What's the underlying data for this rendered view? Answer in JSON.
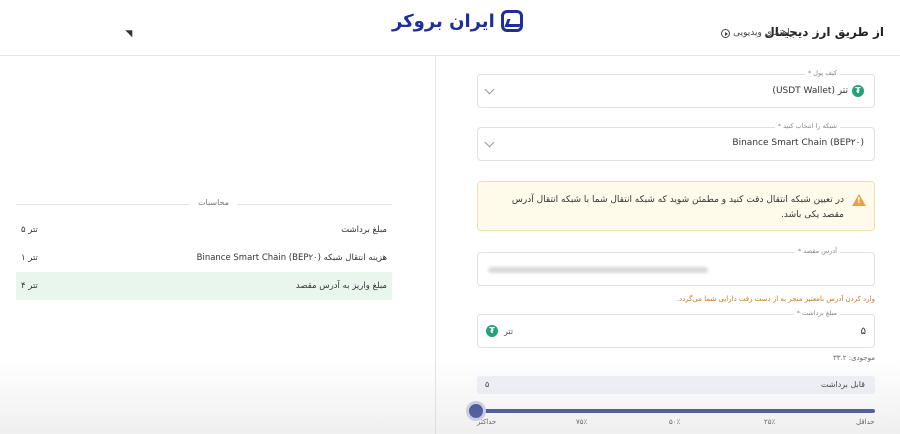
{
  "header": {
    "title": "از طریق ارز دیجیتال",
    "video_guide": "راهنمای ویدیویی",
    "logo_text": "ایران بروکر"
  },
  "form": {
    "wallet": {
      "label": "کیف پول *",
      "value": "تتر (USDT Wallet)"
    },
    "network": {
      "label": "شبکه را انتخاب کنید *",
      "value": "Binance Smart Chain (BEP۲۰)"
    },
    "warning": "در تعیین شبکه انتقال دقت کنید و مطمئن شوید که شبکه انتقال شما با شبکه انتقال آدرس مقصد یکی باشد.",
    "address": {
      "label": "آدرس مقصد *",
      "hint": "وارد کردن آدرس نامعتبر منجر به از دست رفت دارایی شما می‌گردد."
    },
    "amount": {
      "label": "مبلغ برداشت *",
      "value": "۵",
      "unit": "تتر"
    },
    "balance": "موجودی: ۳۳.۲",
    "withdrawable": {
      "label": "قابل برداشت",
      "value": "۵"
    },
    "slider": {
      "level_percent": 0,
      "labels": [
        "حداقل",
        "۲۵٪",
        "۵۰٪",
        "۷۵٪",
        "حداکثر"
      ]
    }
  },
  "calc": {
    "legend": "محاسبات",
    "rows": [
      {
        "label": "مبلغ برداشت",
        "value": "۵ تتر"
      },
      {
        "label": "هزینه انتقال شبکه (BEP۲۰) Binance Smart Chain",
        "value": "۱ تتر"
      },
      {
        "label": "مبلغ واریز به آدرس مقصد",
        "value": "۴ تتر"
      }
    ]
  },
  "colors": {
    "brand": "#1d2f9c",
    "slider": "#2b3a8c",
    "tether": "#26a17b",
    "warning_bg": "#fffbea",
    "highlight_bg": "#e9f6ee"
  }
}
